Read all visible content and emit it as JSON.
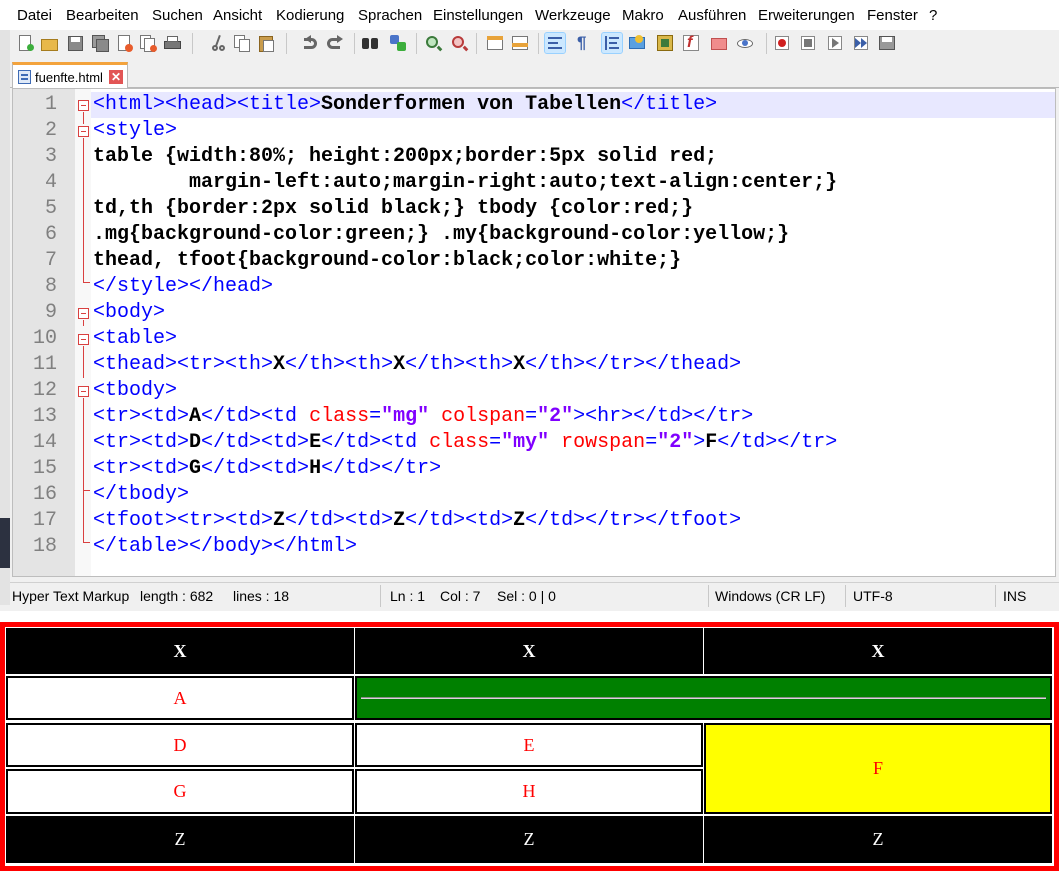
{
  "menu": [
    "Datei",
    "Bearbeiten",
    "Suchen",
    "Ansicht",
    "Kodierung",
    "Sprachen",
    "Einstellungen",
    "Werkzeuge",
    "Makro",
    "Ausführen",
    "Erweiterungen",
    "Fenster",
    "?"
  ],
  "tab": {
    "filename": "fuenfte.html",
    "close": "✕"
  },
  "line_numbers": [
    "1",
    "2",
    "3",
    "4",
    "5",
    "6",
    "7",
    "8",
    "9",
    "10",
    "11",
    "12",
    "13",
    "14",
    "15",
    "16",
    "17",
    "18"
  ],
  "code": {
    "l1": [
      "<html><head><title>",
      "Sonderformen von Tabellen",
      "</title>"
    ],
    "l2": "<style>",
    "l3": "table {width:80%; height:200px;border:5px solid red;",
    "l4": "        margin-left:auto;margin-right:auto;text-align:center;}",
    "l5": "td,th {border:2px solid black;} tbody {color:red;}",
    "l6": ".mg{background-color:green;} .my{background-color:yellow;}",
    "l7": "thead, tfoot{background-color:black;color:white;}",
    "l8": "</style></head>",
    "l9": "<body>",
    "l10": "<table>",
    "l11": [
      "<thead><tr><th>",
      "X",
      "</th><th>",
      "X",
      "</th><th>",
      "X",
      "</th></tr></thead>"
    ],
    "l12": "<tbody>",
    "l13": [
      "<tr><td>",
      "A",
      "</td><td ",
      "class",
      "=",
      "\"mg\"",
      " ",
      "colspan",
      "=",
      "\"2\"",
      "><hr></td></tr>"
    ],
    "l14": [
      "<tr><td>",
      "D",
      "</td><td>",
      "E",
      "</td><td ",
      "class",
      "=",
      "\"my\"",
      " ",
      "rowspan",
      "=",
      "\"2\"",
      ">",
      "F",
      "</td></tr>"
    ],
    "l15": [
      "<tr><td>",
      "G",
      "</td><td>",
      "H",
      "</td></tr>"
    ],
    "l16": "</tbody>",
    "l17": [
      "<tfoot><tr><td>",
      "Z",
      "</td><td>",
      "Z",
      "</td><td>",
      "Z",
      "</td></tr></tfoot>"
    ],
    "l18": "</table></body></html>"
  },
  "status": {
    "language": "Hyper Text Markup",
    "length": "length : 682",
    "lines": "lines : 18",
    "ln": "Ln : 1",
    "col": "Col : 7",
    "sel": "Sel : 0 | 0",
    "eol": "Windows (CR LF)",
    "encoding": "UTF-8",
    "mode": "INS"
  },
  "preview": {
    "header": [
      "X",
      "X",
      "X"
    ],
    "row1": [
      "A"
    ],
    "row2": [
      "D",
      "E",
      "F"
    ],
    "row3": [
      "G",
      "H"
    ],
    "footer": [
      "Z",
      "Z",
      "Z"
    ]
  },
  "colors": {
    "tag": "#0000ff",
    "attribute": "#ff0000",
    "attr_value": "#8000ff",
    "table_border": "#ff0000",
    "mg": "#008000",
    "my": "#ffff00"
  }
}
